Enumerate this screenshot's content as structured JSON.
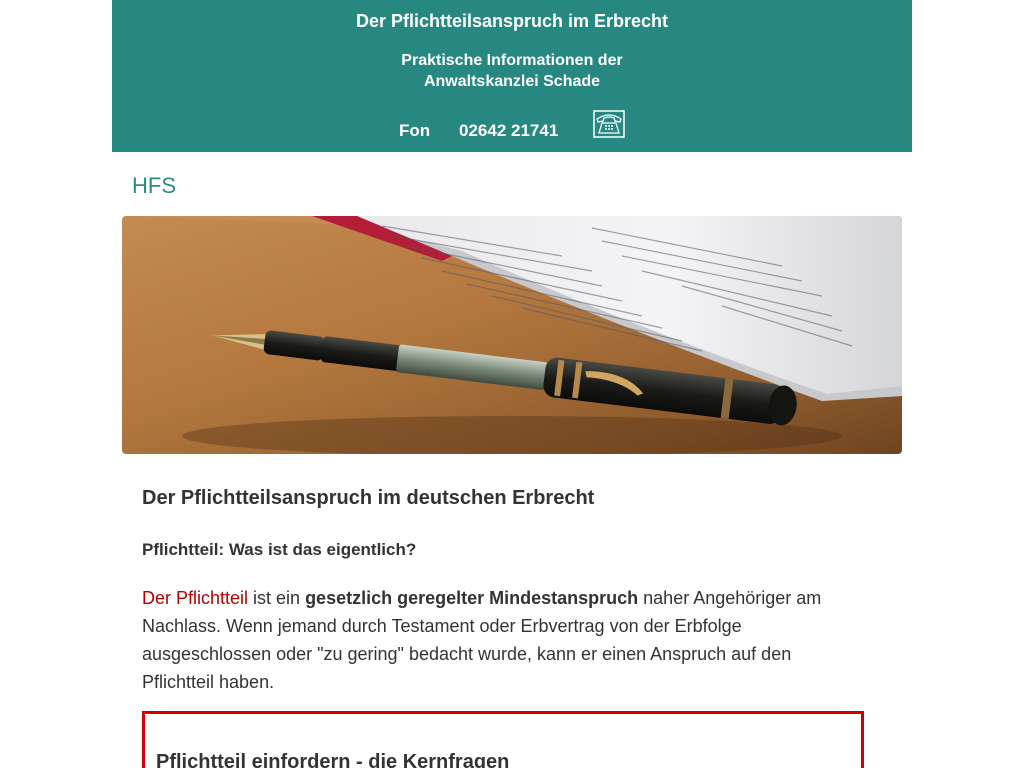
{
  "header": {
    "title": "Der Pflichtteilsanspruch im Erbrecht",
    "subtitle_line1": "Praktische Informationen der",
    "subtitle_line2": "Anwaltskanzlei Schade",
    "phone_label": "Fon",
    "phone_number": "02642 21741",
    "phone_icon": "telephone-icon",
    "background_color": "#278781"
  },
  "site": {
    "name": "HFS"
  },
  "hero": {
    "image": "fountain-pen-on-document"
  },
  "article": {
    "heading": "Der Pflichtteilsanspruch im deutschen Erbrecht",
    "subheading": "Pflichtteil: Was ist das eigentlich?",
    "intro_link": "Der Pflichtteil",
    "intro_text_1": " ist ein ",
    "intro_bold": "gesetzlich geregelter Mindestanspruch",
    "intro_text_2": " naher Angehöriger am Nachlass. Wenn jemand durch Testament oder Erbvertrag von der Erbfolge ausgeschlossen oder \"zu gering\" bedacht wurde, kann er einen Anspruch auf den Pflichtteil haben.",
    "link_color": "#b30000"
  },
  "box": {
    "title": "Pflichtteil einfordern - die Kernfragen",
    "border_color": "#d40000"
  }
}
